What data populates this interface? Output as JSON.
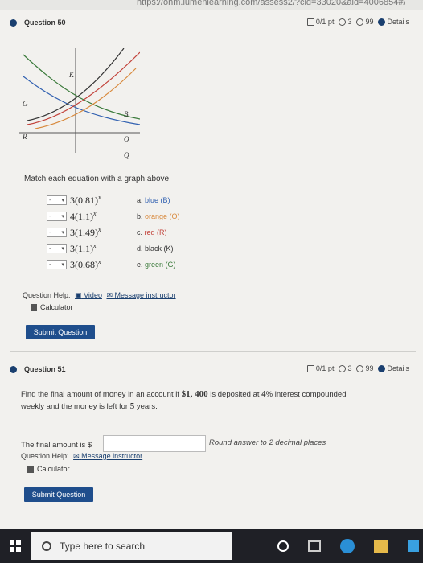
{
  "browser": {
    "url": "https://ohm.lumenlearning.com/assess2/?cid=33020&aid=4006854#/"
  },
  "q50": {
    "title": "Question 50",
    "score": "0/1 pt",
    "retries": "3",
    "attempts": "99",
    "details": "Details",
    "graph_labels": {
      "K": "K",
      "G": "G",
      "B": "B",
      "R": "R",
      "O": "O",
      "Q": "Q"
    },
    "instruction": "Match each equation with a graph above",
    "equations": [
      {
        "base": "3(0.81)",
        "exp": "x"
      },
      {
        "base": "4(1.1)",
        "exp": "x"
      },
      {
        "base": "3(1.49)",
        "exp": "x"
      },
      {
        "base": "3(1.1)",
        "exp": "x"
      },
      {
        "base": "3(0.68)",
        "exp": "x"
      }
    ],
    "select_default": "-",
    "options": [
      {
        "letter": "a.",
        "label": "blue (B)"
      },
      {
        "letter": "b.",
        "label": "orange (O)"
      },
      {
        "letter": "c.",
        "label": "red (R)"
      },
      {
        "letter": "d.",
        "label": "black (K)"
      },
      {
        "letter": "e.",
        "label": "green (G)"
      }
    ],
    "help_label": "Question Help:",
    "video": "Video",
    "message": "Message instructor",
    "calculator": "Calculator",
    "submit": "Submit Question"
  },
  "q51": {
    "title": "Question 51",
    "score": "0/1 pt",
    "retries": "3",
    "attempts": "99",
    "details": "Details",
    "text_a": "Find the final amount of money in an account if ",
    "amount": "$1, 400",
    "text_b": " is deposited at ",
    "rate": "4",
    "pct": "%",
    "text_c": " interest compounded",
    "text_d": "weekly and the money is left for ",
    "years": "5",
    "text_e": " years.",
    "answer_label": "The final amount is $",
    "hint": "Round answer to 2 decimal places",
    "help_label": "Question Help:",
    "message": "Message instructor",
    "calculator": "Calculator",
    "submit": "Submit Question"
  },
  "taskbar": {
    "search_placeholder": "Type here to search"
  },
  "colors": {
    "blue": "#2f5fb0",
    "orange": "#d8893c",
    "red": "#c2423a",
    "black": "#333333",
    "green": "#3a7a3a",
    "accent": "#1f4e8c"
  }
}
